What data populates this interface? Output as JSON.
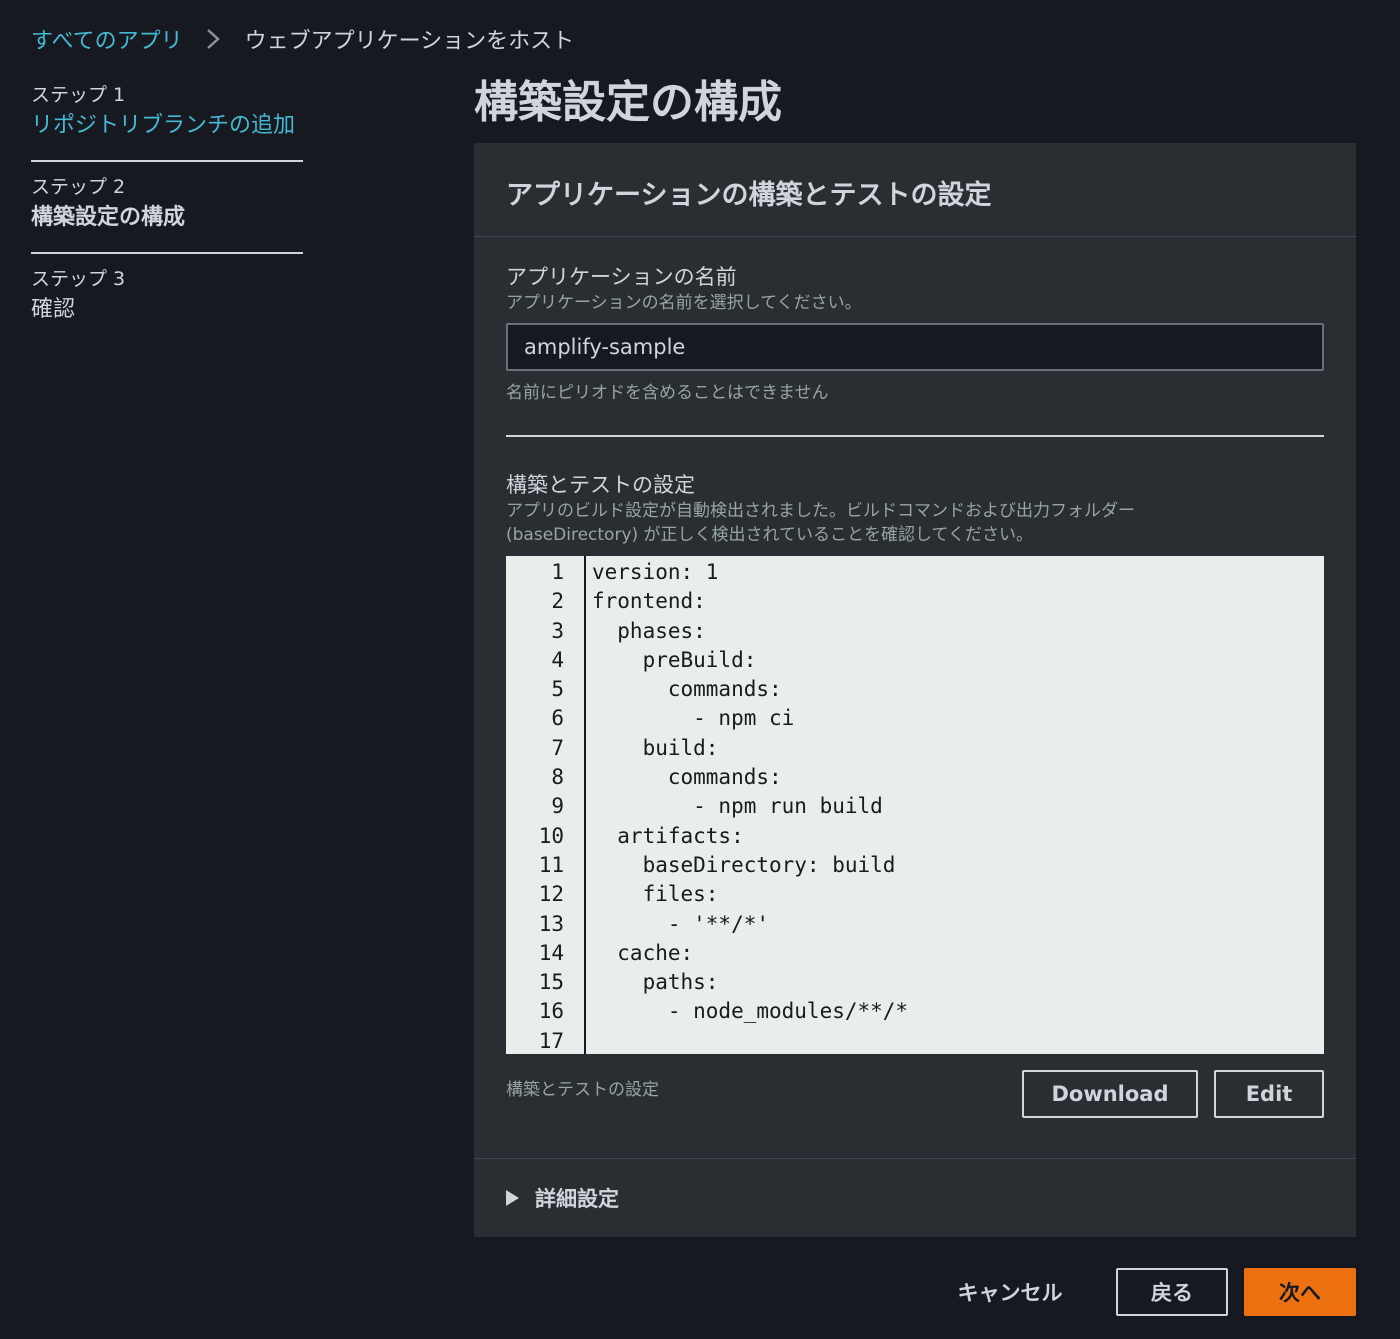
{
  "breadcrumb": {
    "root": "すべてのアプリ",
    "current": "ウェブアプリケーションをホスト"
  },
  "steps": [
    {
      "num": "ステップ 1",
      "title": "リポジトリブランチの追加"
    },
    {
      "num": "ステップ 2",
      "title": "構築設定の構成"
    },
    {
      "num": "ステップ 3",
      "title": "確認"
    }
  ],
  "page_title": "構築設定の構成",
  "panel": {
    "header": "アプリケーションの構築とテストの設定",
    "app_name": {
      "label": "アプリケーションの名前",
      "description": "アプリケーションの名前を選択してください。",
      "value": "amplify-sample",
      "hint": "名前にピリオドを含めることはできません"
    },
    "build": {
      "label": "構築とテストの設定",
      "description_line1": "アプリのビルド設定が自動検出されました。ビルドコマンドおよび出力フォルダー",
      "description_line2": "(baseDirectory) が正しく検出されていることを確認してください。",
      "footer_label": "構築とテストの設定",
      "download_label": "Download",
      "edit_label": "Edit"
    },
    "advanced_label": "詳細設定"
  },
  "code_lines": [
    "version: 1",
    "frontend:",
    "  phases:",
    "    preBuild:",
    "      commands:",
    "        - npm ci",
    "    build:",
    "      commands:",
    "        - npm run build",
    "  artifacts:",
    "    baseDirectory: build",
    "    files:",
    "      - '**/*'",
    "  cache:",
    "    paths:",
    "      - node_modules/**/*",
    ""
  ],
  "line_numbers": [
    "1",
    "2",
    "3",
    "4",
    "5",
    "6",
    "7",
    "8",
    "9",
    "10",
    "11",
    "12",
    "13",
    "14",
    "15",
    "16",
    "17"
  ],
  "footer": {
    "cancel_label": "キャンセル",
    "back_label": "戻る",
    "next_label": "次へ"
  }
}
